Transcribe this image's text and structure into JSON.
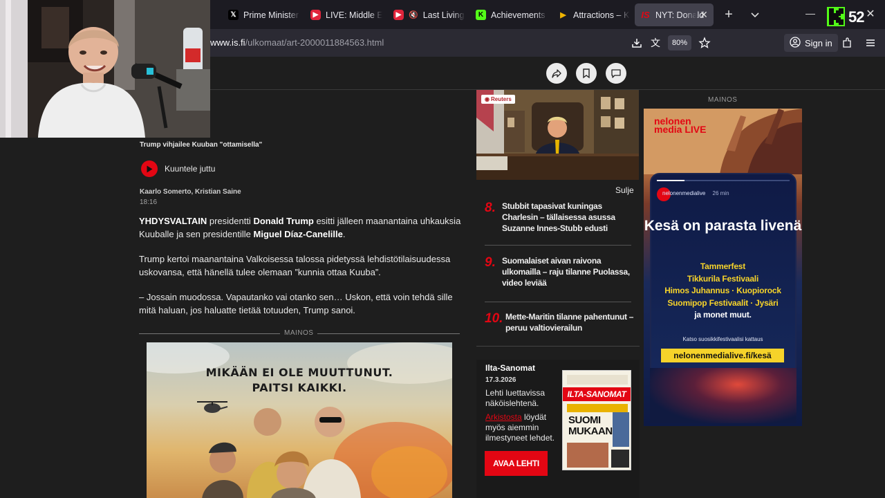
{
  "browser": {
    "tabs": [
      {
        "label": "Prime Minister",
        "favicon": "x-icon"
      },
      {
        "label": "LIVE: Middle Ea",
        "favicon": "youtube-icon"
      },
      {
        "label": "Last Living",
        "favicon": "youtube-icon"
      },
      {
        "label": "Achievements",
        "favicon": "kick-k-icon"
      },
      {
        "label": "Attractions – K",
        "favicon": "flag-icon"
      },
      {
        "label": "NYT: Donald",
        "favicon": "is-icon",
        "active": true
      }
    ],
    "url_domain": "www.is.fi",
    "url_path": "/ulkomaat/art-2000011884563.html",
    "zoom": "80%",
    "signin_label": "Sign in"
  },
  "overlay": {
    "kick_viewers": "52"
  },
  "article": {
    "image_caption": "Trump vihjailee Kuuban \"ottamisella\"",
    "listen_label": "Kuuntele juttu",
    "authors": "Kaarlo Somerto, Kristian Saine",
    "time": "18:16",
    "p1": {
      "lead": "YHDYSVALTAIN",
      "t1": " presidentti ",
      "name1": "Donald Trump",
      "t2": " esitti jälleen maanantaina uhkauksia Kuuballe ja sen presidentille ",
      "name2": "Miguel Díaz-Canelille",
      "t3": "."
    },
    "p2": "Trump kertoi maanantaina Valkoisessa talossa pidetyssä lehdistötilaisuudessa uskovansa, että hänellä tulee olemaan ”kunnia ottaa Kuuba”.",
    "p3": "– Jossain muodossa. Vapautanko vai otanko sen… Uskon, että voin tehdä sille mitä haluan, jos haluatte tietää totuuden, Trump sanoi.",
    "ad_label": "MAINOS",
    "ad_text_line1": "MIKÄÄN EI OLE MUUTTUNUT.",
    "ad_text_line2": "PAITSI KAIKKI."
  },
  "sidebar": {
    "video_source": "Reuters",
    "close_label": "Sulje",
    "list": [
      {
        "num": "8.",
        "text": "Stubbit tapasivat kuningas Charlesin – tällaisessa asussa Suzanne Innes-Stubb edusti"
      },
      {
        "num": "9.",
        "text": "Suomalaiset aivan raivona ulkomailla – raju tilanne Puolassa, video leviää"
      },
      {
        "num": "10.",
        "text": "Mette-Maritin tilanne pahentunut – peruu valtiovierailun"
      }
    ],
    "paper": {
      "title": "Ilta-Sanomat",
      "date": "17.3.2026",
      "desc": "Lehti luettavissa näköislehtenä.",
      "archive_link": "Arkistosta",
      "archive_rest": " löydät myös aiemmin ilmestyneet lehdet.",
      "button": "AVAA LEHTI",
      "cover_masthead": "ILTA-SANOMAT",
      "cover_headline": "SUOMI MUKAAN?"
    }
  },
  "right_ad": {
    "label": "MAINOS",
    "brand": "nelonen media LIVE",
    "account": "nelonenmedialive",
    "age": "26 min",
    "title": "Kesä on parasta livenä",
    "events": [
      "Tammerfest",
      "Tikkurila Festivaali",
      "Himos Juhannus · Kuopiorock",
      "Suomipop Festivaalit · Jysäri"
    ],
    "events_tail": "ja monet muut.",
    "small": "Katso suosikkifestivaalisi kattaus",
    "url": "nelonenmedialive.fi/kesä"
  },
  "colors": {
    "accent_red": "#e30613",
    "kick_green": "#53fc18",
    "ad_yellow": "#f6d32a"
  }
}
